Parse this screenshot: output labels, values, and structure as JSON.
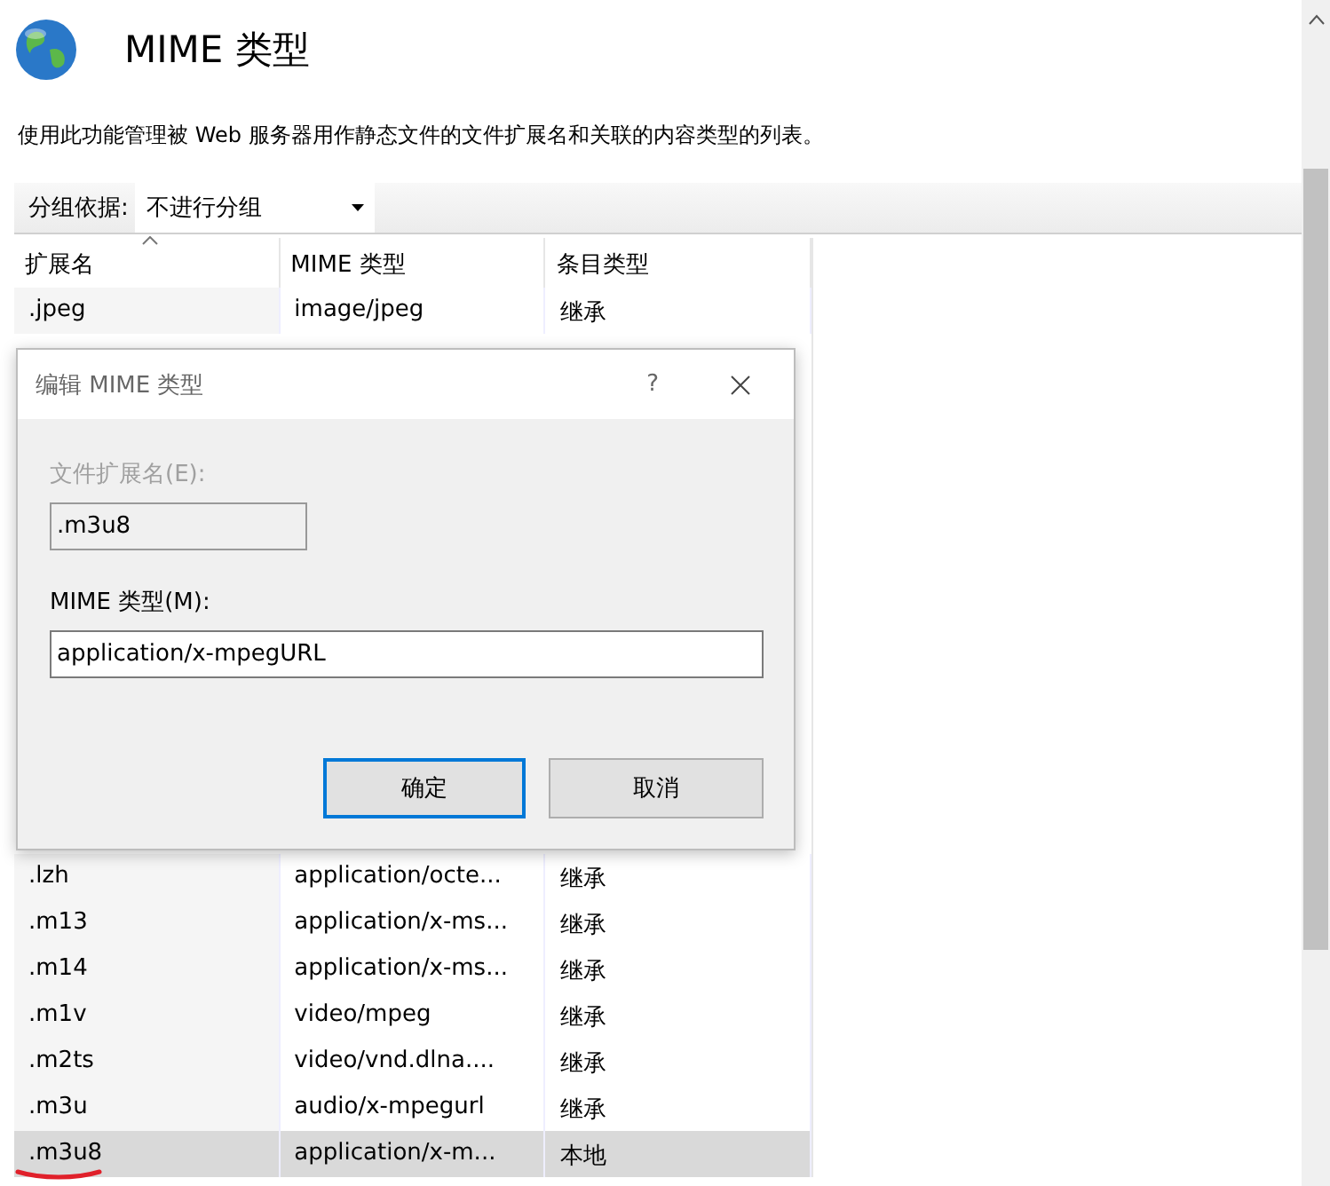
{
  "header": {
    "title": "MIME 类型",
    "description": "使用此功能管理被 Web 服务器用作静态文件的文件扩展名和关联的内容类型的列表。"
  },
  "toolbar": {
    "group_label": "分组依据:",
    "group_value": "不进行分组"
  },
  "table": {
    "columns": [
      "扩展名",
      "MIME 类型",
      "条目类型"
    ],
    "rows_top": [
      {
        "cells": [
          ".jpeg",
          "image/jpeg",
          "继承"
        ],
        "selected": false
      }
    ],
    "rows_bottom": [
      {
        "cells": [
          ".lzh",
          "application/octe...",
          "继承"
        ],
        "selected": false
      },
      {
        "cells": [
          ".m13",
          "application/x-ms...",
          "继承"
        ],
        "selected": false
      },
      {
        "cells": [
          ".m14",
          "application/x-ms...",
          "继承"
        ],
        "selected": false
      },
      {
        "cells": [
          ".m1v",
          "video/mpeg",
          "继承"
        ],
        "selected": false
      },
      {
        "cells": [
          ".m2ts",
          "video/vnd.dlna....",
          "继承"
        ],
        "selected": false
      },
      {
        "cells": [
          ".m3u",
          "audio/x-mpegurl",
          "继承"
        ],
        "selected": false
      },
      {
        "cells": [
          ".m3u8",
          "application/x-m...",
          "本地"
        ],
        "selected": true
      }
    ]
  },
  "dialog": {
    "title": "编辑 MIME 类型",
    "help": "?",
    "ext_label": "文件扩展名(E):",
    "ext_value": ".m3u8",
    "ext_disabled": true,
    "mime_label": "MIME 类型(M):",
    "mime_value": "application/x-mpegURL",
    "ok": "确定",
    "cancel": "取消"
  }
}
